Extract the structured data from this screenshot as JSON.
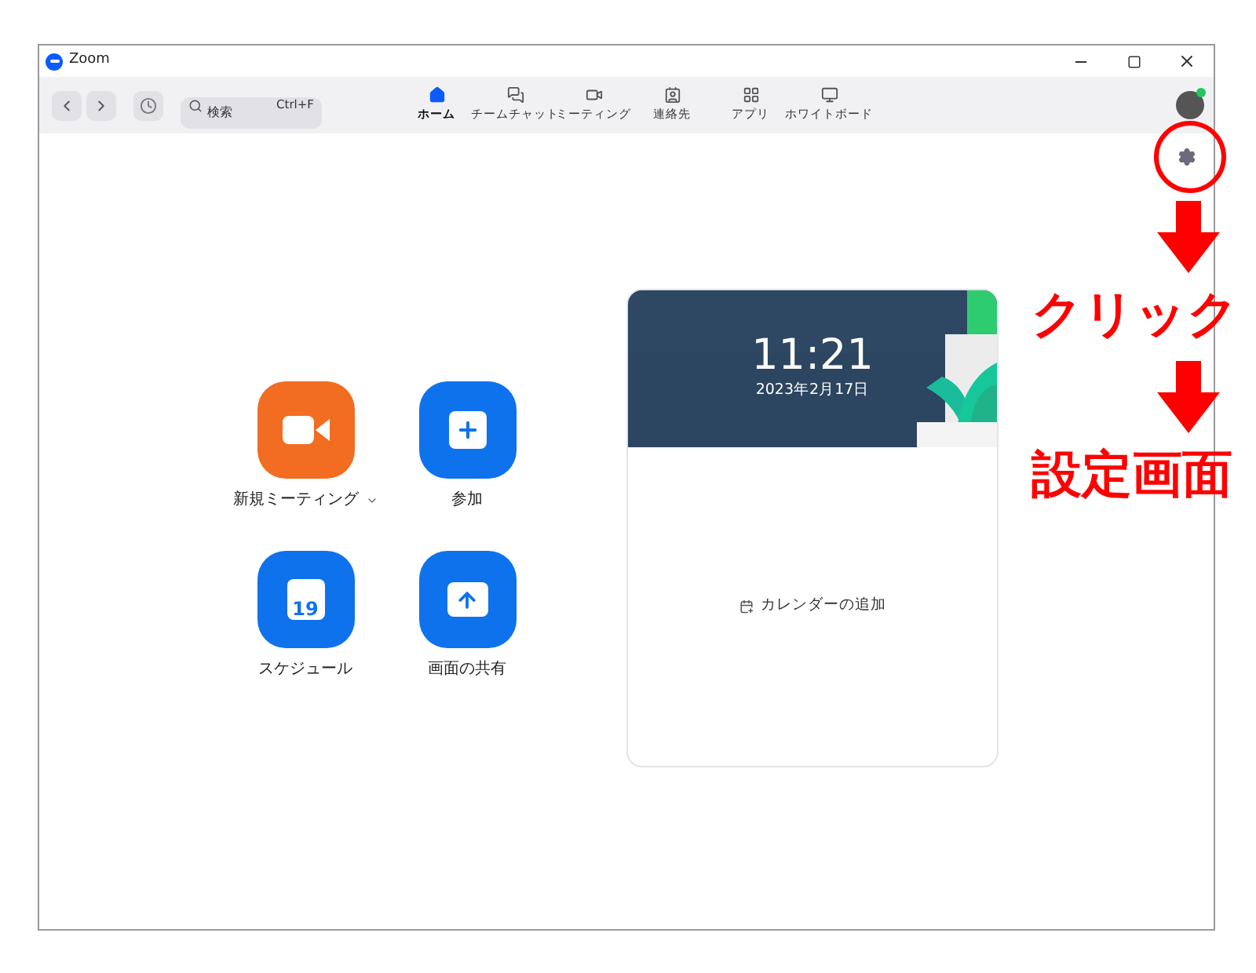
{
  "window": {
    "title": "Zoom"
  },
  "search": {
    "placeholder": "検索",
    "shortcut": "Ctrl+F"
  },
  "tabs": [
    {
      "label": "ホーム",
      "kind": "home",
      "selected": true
    },
    {
      "label": "チームチャット",
      "kind": "chat",
      "selected": false
    },
    {
      "label": "ミーティング",
      "kind": "video",
      "selected": false
    },
    {
      "label": "連絡先",
      "kind": "contacts",
      "selected": false
    },
    {
      "label": "アプリ",
      "kind": "apps",
      "selected": false
    },
    {
      "label": "ホワイトボード",
      "kind": "whiteboard",
      "selected": false
    }
  ],
  "profile": {
    "online": true
  },
  "actions": [
    {
      "label": "新規ミーティング",
      "kind": "video",
      "color": "#f26d21",
      "has_menu": true
    },
    {
      "label": "参加",
      "kind": "plus",
      "color": "#0e72ed",
      "has_menu": false
    },
    {
      "label": "スケジュール",
      "kind": "calendar",
      "color": "#0e72ed",
      "has_menu": false,
      "icon_text": "19"
    },
    {
      "label": "画面の共有",
      "kind": "share",
      "color": "#0e72ed",
      "has_menu": false
    }
  ],
  "clock": {
    "time": "11:21",
    "date": "2023年2月17日"
  },
  "calendar": {
    "link": "カレンダーの追加"
  },
  "annotations": [
    "クリック",
    "設定画面"
  ]
}
